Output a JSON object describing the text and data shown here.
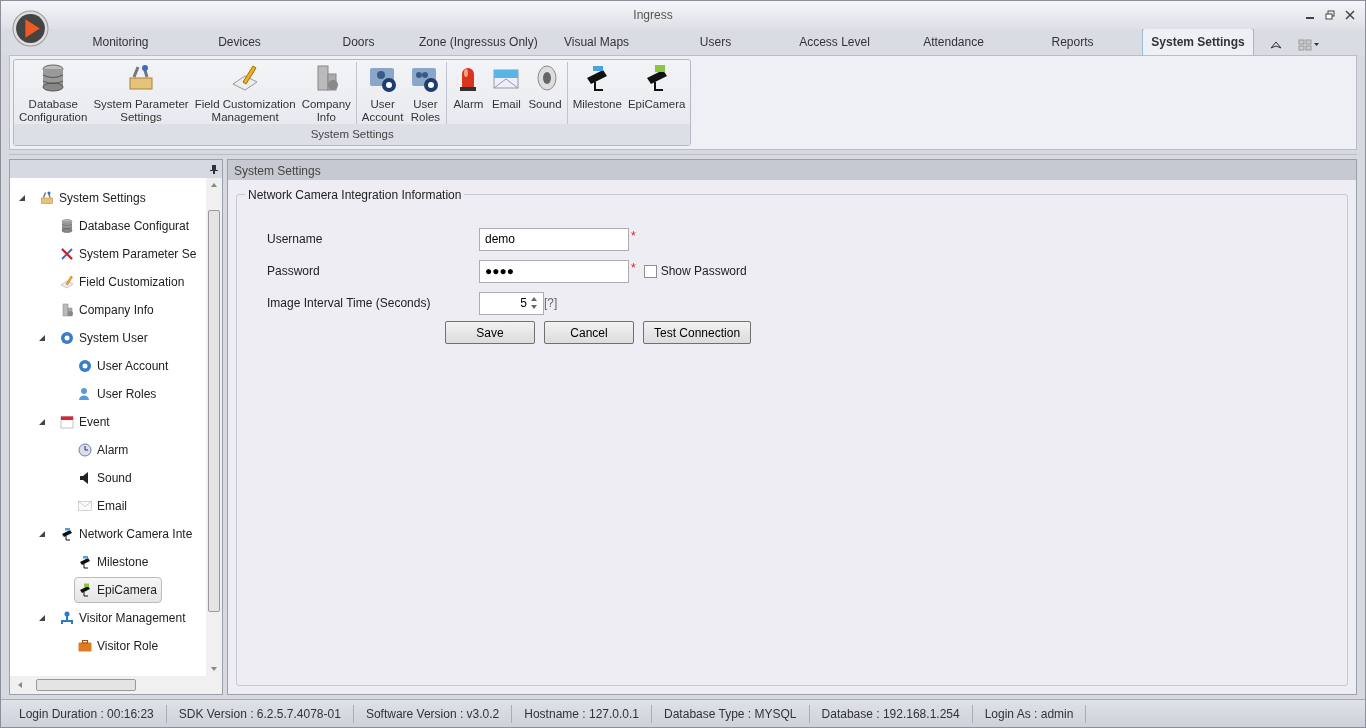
{
  "window": {
    "title": "Ingress"
  },
  "tabs": [
    {
      "label": "Monitoring",
      "selected": false
    },
    {
      "label": "Devices",
      "selected": false
    },
    {
      "label": "Doors",
      "selected": false
    },
    {
      "label": "Zone (Ingressus Only)",
      "selected": false
    },
    {
      "label": "Visual Maps",
      "selected": false
    },
    {
      "label": "Users",
      "selected": false
    },
    {
      "label": "Access Level",
      "selected": false
    },
    {
      "label": "Attendance",
      "selected": false
    },
    {
      "label": "Reports",
      "selected": false
    },
    {
      "label": "System Settings",
      "selected": true
    }
  ],
  "ribbon": {
    "group_label": "System Settings",
    "sections": [
      [
        {
          "label": "Database Configuration"
        },
        {
          "label": "System Parameter Settings"
        },
        {
          "label": "Field Customization Management"
        },
        {
          "label": "Company Info"
        }
      ],
      [
        {
          "label": "User Account"
        },
        {
          "label": "User Roles"
        }
      ],
      [
        {
          "label": "Alarm"
        },
        {
          "label": "Email"
        },
        {
          "label": "Sound"
        }
      ],
      [
        {
          "label": "Milestone"
        },
        {
          "label": "EpiCamera"
        }
      ]
    ]
  },
  "tree": [
    {
      "label": "System Settings",
      "expanded": true,
      "selected": false,
      "children": [
        {
          "label": "Database Configurat",
          "selected": false
        },
        {
          "label": "System Parameter Se",
          "selected": false
        },
        {
          "label": "Field Customization",
          "selected": false
        },
        {
          "label": "Company Info",
          "selected": false
        },
        {
          "label": "System User",
          "expanded": true,
          "selected": false,
          "children": [
            {
              "label": "User Account",
              "selected": false
            },
            {
              "label": "User Roles",
              "selected": false
            }
          ]
        },
        {
          "label": "Event",
          "expanded": true,
          "selected": false,
          "children": [
            {
              "label": "Alarm",
              "selected": false
            },
            {
              "label": "Sound",
              "selected": false
            },
            {
              "label": "Email",
              "selected": false
            }
          ]
        },
        {
          "label": "Network Camera Inte",
          "expanded": true,
          "selected": false,
          "children": [
            {
              "label": "Milestone",
              "selected": false
            },
            {
              "label": "EpiCamera",
              "selected": true
            }
          ]
        },
        {
          "label": "Visitor Management",
          "expanded": true,
          "selected": false,
          "children": [
            {
              "label": "Visitor Role",
              "selected": false
            }
          ]
        }
      ]
    }
  ],
  "panel": {
    "title": "System Settings",
    "group_title": "Network Camera Integration Information",
    "fields": [
      {
        "kind": "text",
        "label": "Username",
        "value": "demo",
        "required_mark": "*"
      },
      {
        "kind": "password",
        "label": "Password",
        "value": "●●●●",
        "required_mark": "*",
        "checkbox": {
          "label": "Show Password",
          "checked": false
        }
      },
      {
        "kind": "spinner",
        "label": "Image Interval Time (Seconds)",
        "value": "5",
        "hint": "[?]"
      }
    ],
    "buttons": [
      "Save",
      "Cancel",
      "Test Connection"
    ]
  },
  "status_bar": [
    "Login Duration : 00:16:23",
    "SDK Version : 6.2.5.7.4078-01",
    "Software Version : v3.0.2",
    "Hostname : 127.0.0.1",
    "Database Type : MYSQL",
    "Database : 192.168.1.254",
    "Login As : admin"
  ]
}
